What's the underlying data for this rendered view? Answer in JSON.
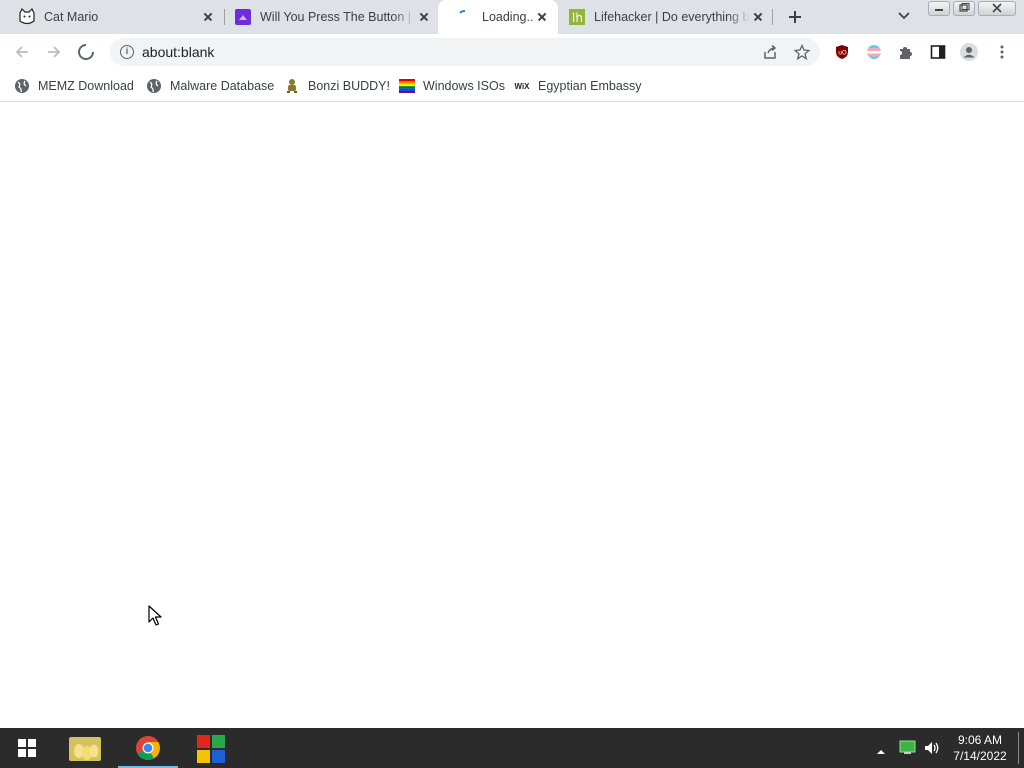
{
  "tabs": [
    {
      "title": "Cat Mario",
      "favicon": "cat-icon",
      "active": false
    },
    {
      "title": "Will You Press The Button | E",
      "favicon": "purple-button-icon",
      "active": false
    },
    {
      "title": "Loading...",
      "favicon": "loading-spinner-icon",
      "active": true
    },
    {
      "title": "Lifehacker | Do everything b",
      "favicon": "lifehacker-icon",
      "active": false
    }
  ],
  "toolbar": {
    "url": "about:blank",
    "extensions": [
      "ublock-icon",
      "flag-extension-icon",
      "puzzle-icon",
      "side-panel-icon",
      "profile-icon",
      "menu-icon"
    ]
  },
  "bookmarks": [
    {
      "label": "MEMZ Download",
      "icon": "globe-icon"
    },
    {
      "label": "Malware Database",
      "icon": "globe-icon"
    },
    {
      "label": "Bonzi BUDDY!",
      "icon": "bonzi-icon"
    },
    {
      "label": "Windows ISOs",
      "icon": "rainbow-flag-icon"
    },
    {
      "label": "Egyptian Embassy",
      "icon": "wix-icon"
    }
  ],
  "bookmark_wix_text": "WiX",
  "taskbar": {
    "apps": [
      "start-icon",
      "file-explorer-icon",
      "chrome-icon",
      "app-icon"
    ],
    "time": "9:06 AM",
    "date": "7/14/2022"
  },
  "colors": {
    "tabstrip": "#dee1e6",
    "taskbar": "#2b2b2b",
    "taskbar_active": "#76b9ed"
  }
}
